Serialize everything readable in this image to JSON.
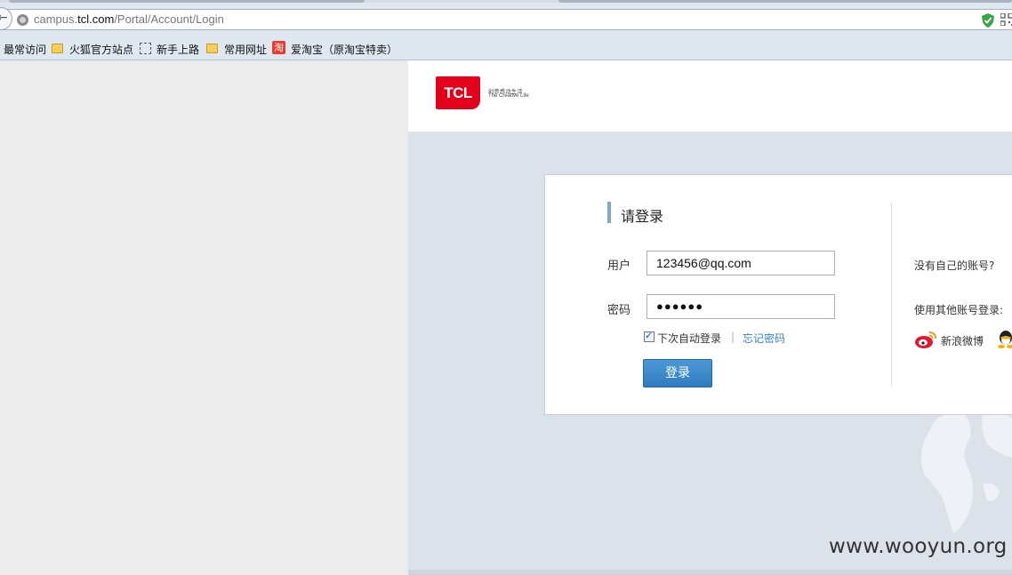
{
  "browser": {
    "url_prefix": "campus.",
    "url_domain": "tcl.com",
    "url_path": "/Portal/Account/Login",
    "bookmarks": [
      {
        "label": "最常访问",
        "icon": "none"
      },
      {
        "label": "火狐官方站点",
        "icon": "folder-icon"
      },
      {
        "label": "新手上路",
        "icon": "dashed-box-icon"
      },
      {
        "label": "常用网址",
        "icon": "folder-icon"
      },
      {
        "label": "爱淘宝（原淘宝特卖）",
        "icon": "taobao-icon"
      }
    ],
    "taobao_glyph": "淘"
  },
  "header": {
    "logo_text": "TCL",
    "slogan_cn": "创意感动生活",
    "slogan_en": "The Creative Life"
  },
  "login": {
    "title": "请登录",
    "username_label": "用户",
    "username_value": "123456@qq.com",
    "password_label": "密码",
    "password_value": "●●●●●●",
    "remember_label": "下次自动登录",
    "remember_checked": true,
    "separator": "|",
    "forgot_label": "忘记密码",
    "submit_label": "登录",
    "no_account_text": "没有自己的账号?",
    "other_login_text": "使用其他账号登录:",
    "weibo_label": "新浪微博"
  },
  "watermark": "www.wooyun.org",
  "colors": {
    "brand_red": "#e3001b",
    "button_blue": "#3a87c8",
    "link_blue": "#3a7fc1",
    "page_bg": "#dbe2ea"
  }
}
